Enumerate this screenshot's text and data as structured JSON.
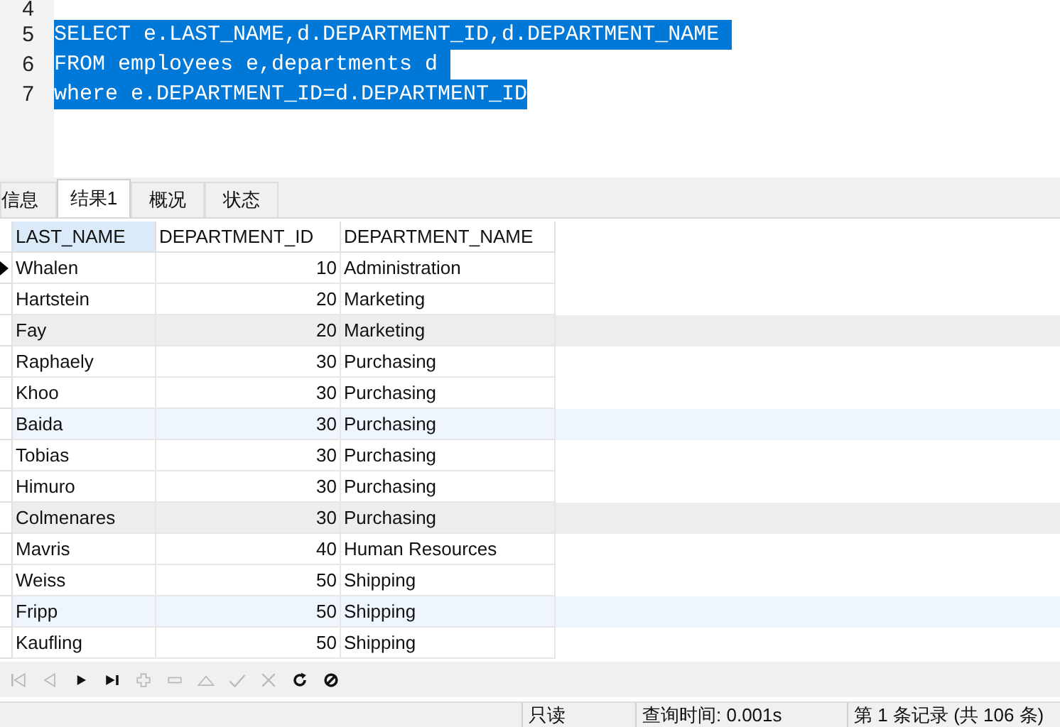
{
  "editor": {
    "lines": [
      {
        "number": "4"
      },
      {
        "number": "5",
        "code": "SELECT e.LAST_NAME,d.DEPARTMENT_ID,d.DEPARTMENT_NAME ",
        "selected": true
      },
      {
        "number": "6",
        "code": "FROM employees e,departments d ",
        "selected": true
      },
      {
        "number": "7",
        "code": "where e.DEPARTMENT_ID=d.DEPARTMENT_ID",
        "selected": true
      }
    ]
  },
  "tabs": [
    {
      "label": "信息",
      "selected": false
    },
    {
      "label": "结果1",
      "selected": true
    },
    {
      "label": "概况",
      "selected": false
    },
    {
      "label": "状态",
      "selected": false
    }
  ],
  "table": {
    "columns": [
      "LAST_NAME",
      "DEPARTMENT_ID",
      "DEPARTMENT_NAME"
    ],
    "rows": [
      {
        "cells": [
          "Whalen",
          "10",
          "Administration"
        ],
        "current": true,
        "kind": "plain"
      },
      {
        "cells": [
          "Hartstein",
          "20",
          "Marketing"
        ],
        "current": false,
        "kind": "plain"
      },
      {
        "cells": [
          "Fay",
          "20",
          "Marketing"
        ],
        "current": false,
        "kind": "gray"
      },
      {
        "cells": [
          "Raphaely",
          "30",
          "Purchasing"
        ],
        "current": false,
        "kind": "plain"
      },
      {
        "cells": [
          "Khoo",
          "30",
          "Purchasing"
        ],
        "current": false,
        "kind": "plain"
      },
      {
        "cells": [
          "Baida",
          "30",
          "Purchasing"
        ],
        "current": false,
        "kind": "blue"
      },
      {
        "cells": [
          "Tobias",
          "30",
          "Purchasing"
        ],
        "current": false,
        "kind": "plain"
      },
      {
        "cells": [
          "Himuro",
          "30",
          "Purchasing"
        ],
        "current": false,
        "kind": "plain"
      },
      {
        "cells": [
          "Colmenares",
          "30",
          "Purchasing"
        ],
        "current": false,
        "kind": "gray"
      },
      {
        "cells": [
          "Mavris",
          "40",
          "Human Resources"
        ],
        "current": false,
        "kind": "plain"
      },
      {
        "cells": [
          "Weiss",
          "50",
          "Shipping"
        ],
        "current": false,
        "kind": "plain"
      },
      {
        "cells": [
          "Fripp",
          "50",
          "Shipping"
        ],
        "current": false,
        "kind": "blue"
      },
      {
        "cells": [
          "Kaufling",
          "50",
          "Shipping"
        ],
        "current": false,
        "kind": "plain"
      }
    ]
  },
  "toolbar": [
    {
      "kind": "first",
      "disabled": true
    },
    {
      "kind": "prev",
      "disabled": true
    },
    {
      "kind": "next",
      "disabled": false
    },
    {
      "kind": "last",
      "disabled": false
    },
    {
      "kind": "add",
      "disabled": true
    },
    {
      "kind": "remove",
      "disabled": true
    },
    {
      "kind": "apply",
      "disabled": true
    },
    {
      "kind": "check",
      "disabled": true
    },
    {
      "kind": "discard",
      "disabled": true
    },
    {
      "kind": "refresh",
      "disabled": false
    },
    {
      "kind": "stop",
      "disabled": false
    }
  ],
  "status_bar": [
    "只读",
    "查询时间: 0.001s",
    "第 1 条记录 (共 106 条)"
  ]
}
